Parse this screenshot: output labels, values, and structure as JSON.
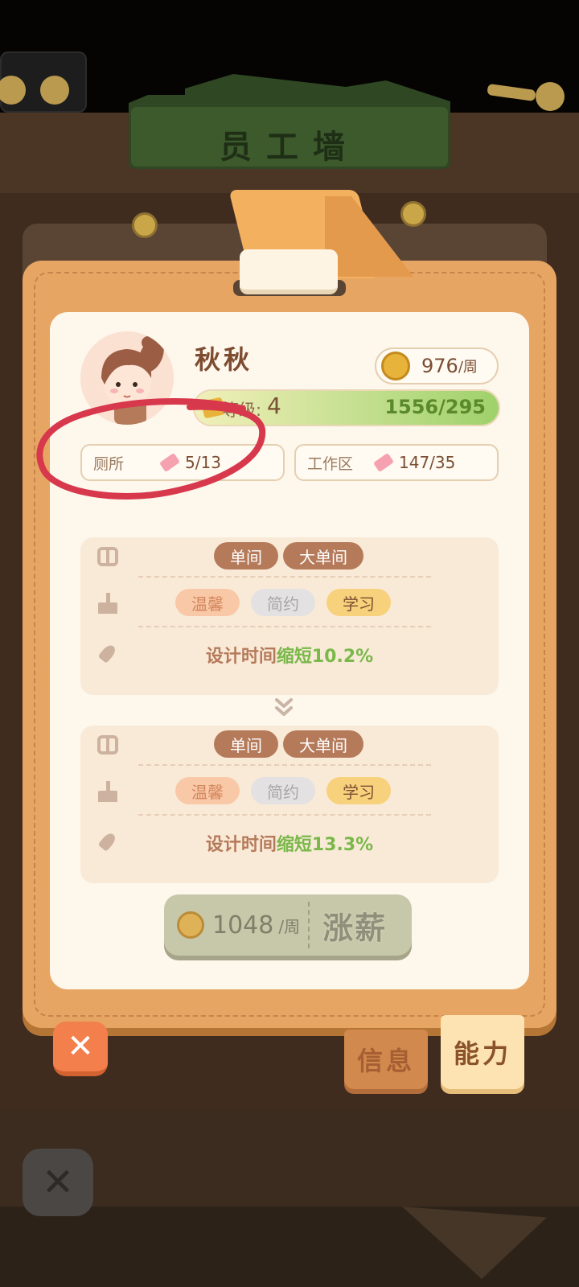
{
  "header": {
    "title": "员工墙"
  },
  "employee": {
    "name": "秋秋",
    "salary": {
      "value": "976",
      "unit": "/周"
    },
    "level": {
      "label": "等级:",
      "value": "4",
      "progress_text": "1556/295",
      "progress_fill": 1.0
    },
    "stats": [
      {
        "label": "厕所",
        "value": "5/13"
      },
      {
        "label": "工作区",
        "value": "147/35"
      }
    ]
  },
  "ability_current": {
    "room_tags": [
      "单间",
      "大单间"
    ],
    "style_tags": [
      "温馨",
      "简约",
      "学习"
    ],
    "effect_prefix": "设计时间",
    "effect_highlight": "缩短10.2%"
  },
  "ability_next": {
    "room_tags": [
      "单间",
      "大单间"
    ],
    "style_tags": [
      "温馨",
      "简约",
      "学习"
    ],
    "effect_prefix": "设计时间",
    "effect_highlight": "缩短13.3%"
  },
  "raise_button": {
    "amount": "1048",
    "unit": "/周",
    "label": "涨薪"
  },
  "tabs": [
    {
      "label": "信息"
    },
    {
      "label": "能力"
    }
  ],
  "colors": {
    "accent_orange": "#e7a563",
    "annotation_red": "#d7384c",
    "effect_green": "#7ab84a"
  }
}
